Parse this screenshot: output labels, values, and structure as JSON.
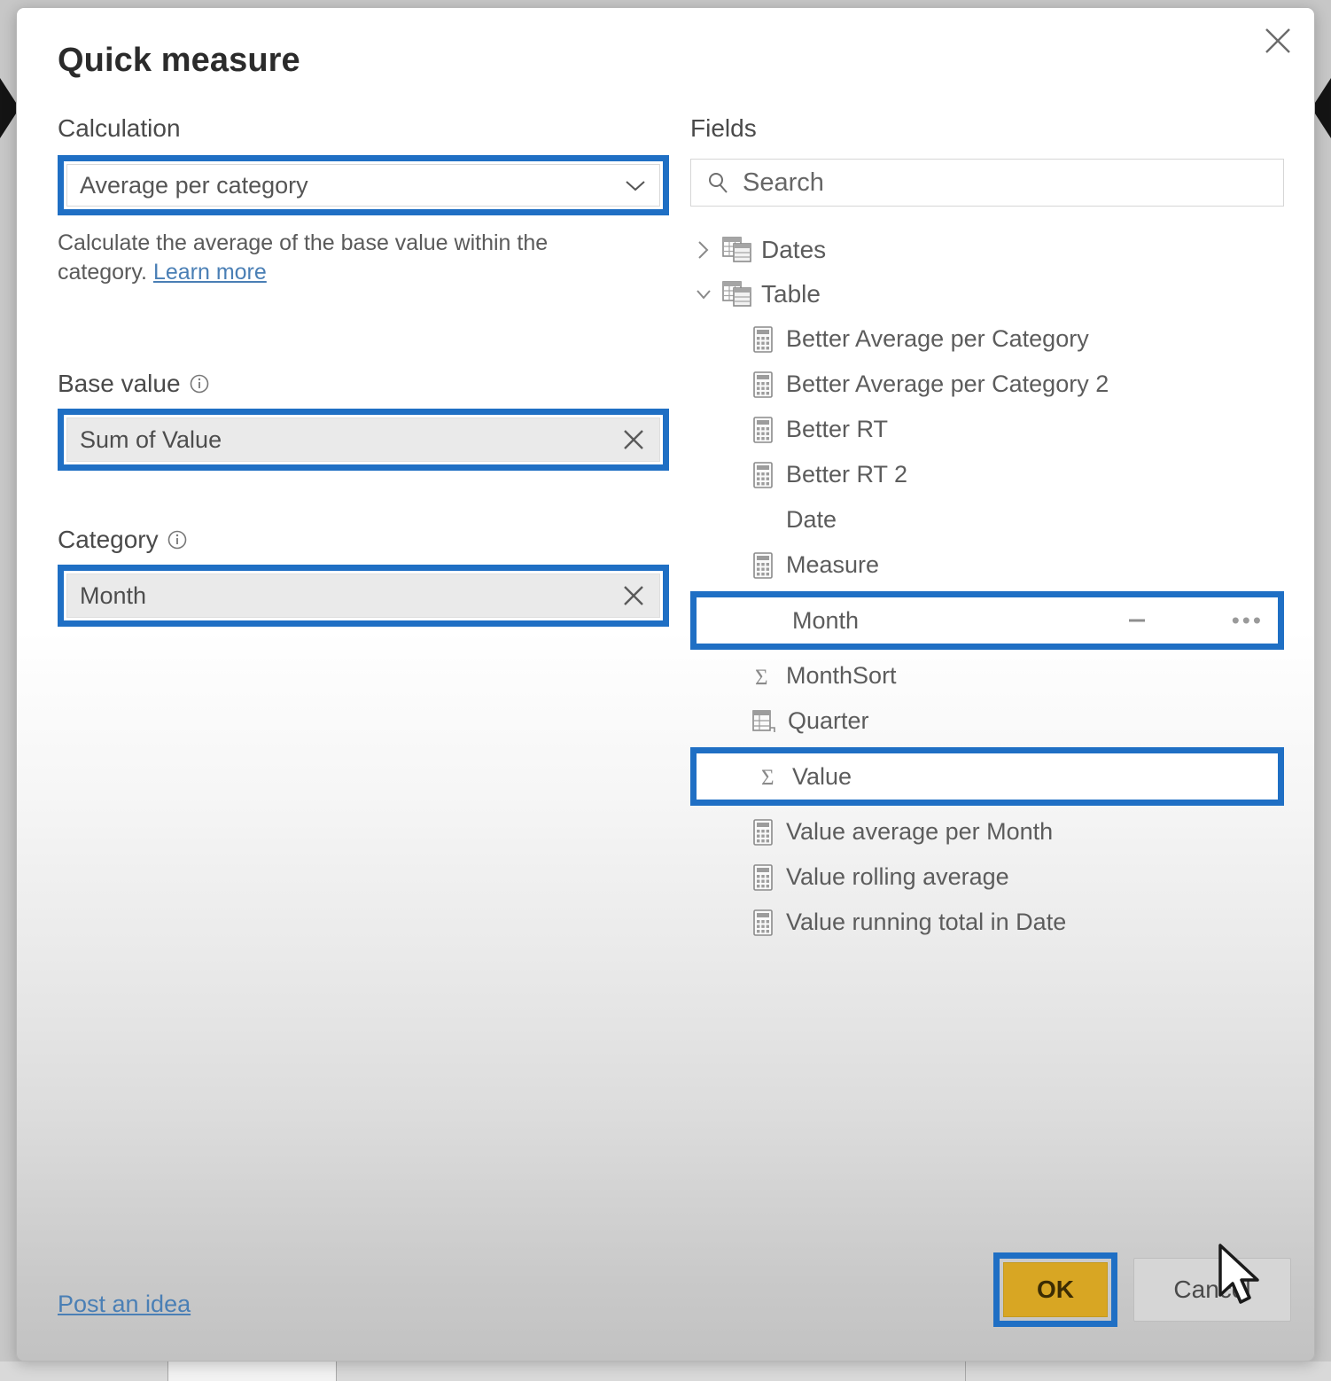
{
  "window": {
    "title": "Quick measure",
    "close_icon": "close-icon"
  },
  "left_panel": {
    "calculation": {
      "label": "Calculation",
      "selected": "Average per category",
      "chevron_icon": "chevron-down-icon",
      "description": "Calculate the average of the base value within the",
      "description_2": "category.",
      "learn_more": "Learn more"
    },
    "base_value": {
      "label": "Base value",
      "info_icon": "info-icon",
      "value": "Sum of Value",
      "clear_icon": "close-icon"
    },
    "category": {
      "label": "Category",
      "info_icon": "info-icon",
      "value": "Month",
      "clear_icon": "close-icon"
    }
  },
  "fields_panel": {
    "title": "Fields",
    "search": {
      "placeholder": "Search",
      "value": "",
      "icon": "search-icon"
    },
    "tables": [
      {
        "name": "Dates",
        "expanded": false,
        "chevron_icon": "chevron-right-icon",
        "table_icon": "table-icon"
      },
      {
        "name": "Table",
        "expanded": true,
        "chevron_icon": "chevron-down-icon",
        "table_icon": "table-icon"
      }
    ],
    "fields": [
      {
        "name": "Better Average per Category",
        "icon": "calculator-icon",
        "highlighted": false
      },
      {
        "name": "Better Average per Category 2",
        "icon": "calculator-icon",
        "highlighted": false
      },
      {
        "name": "Better RT",
        "icon": "calculator-icon",
        "highlighted": false
      },
      {
        "name": "Better RT 2",
        "icon": "calculator-icon",
        "highlighted": false
      },
      {
        "name": "Date",
        "icon": "none",
        "highlighted": false
      },
      {
        "name": "Measure",
        "icon": "calculator-icon",
        "highlighted": false
      },
      {
        "name": "Month",
        "icon": "none",
        "highlighted": true,
        "more_label": "•••"
      },
      {
        "name": "MonthSort",
        "icon": "sigma-icon",
        "highlighted": false
      },
      {
        "name": "Quarter",
        "icon": "hierarchy-icon",
        "highlighted": false
      },
      {
        "name": "Value",
        "icon": "sigma-icon",
        "highlighted": true
      },
      {
        "name": "Value average per Month",
        "icon": "calculator-icon",
        "highlighted": false
      },
      {
        "name": "Value rolling average",
        "icon": "calculator-icon",
        "highlighted": false
      },
      {
        "name": "Value running total in Date",
        "icon": "calculator-icon",
        "highlighted": false
      }
    ]
  },
  "footer": {
    "post_idea": "Post an idea",
    "ok": "OK",
    "cancel": "Cancel"
  },
  "colors": {
    "annotation_blue": "#1f6fc4",
    "ok_gold": "#d8a623",
    "link_blue": "#4a7fb5"
  }
}
